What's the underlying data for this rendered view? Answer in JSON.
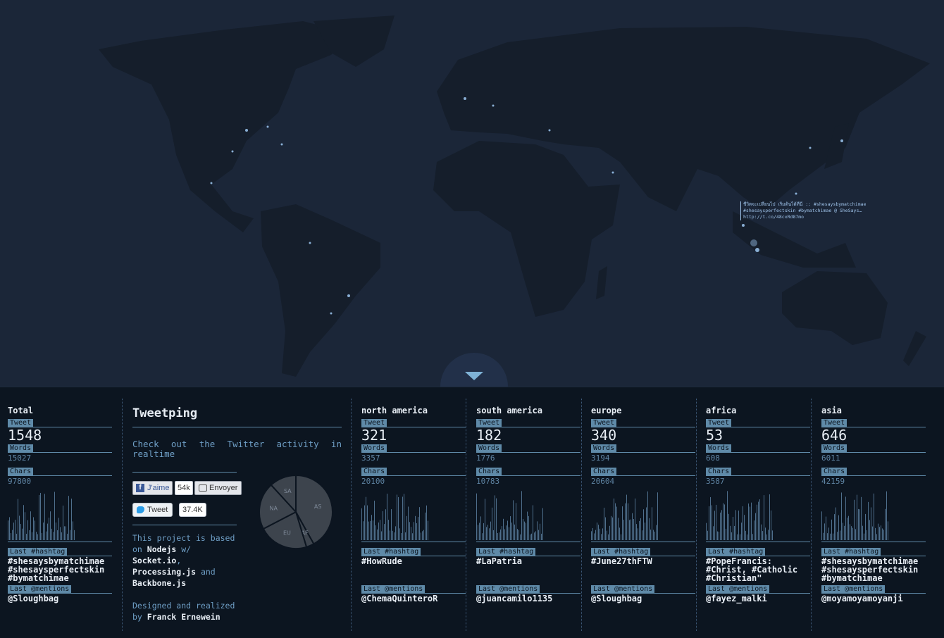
{
  "map": {
    "popup_text": [
      "ชีวิตจะเปลี่ยนไป เริ่มต้นได้ที่นี่ :: #shesaysbymatchimae",
      "#shesaysperfectskin #bymatchimae @ SheSays…",
      "http://t.co/48cxRd87mo"
    ]
  },
  "total": {
    "title": "Total",
    "tweet_label": "Tweet",
    "tweets": "1548",
    "words_label": "Words",
    "words": "15027",
    "chars_label": "Chars",
    "chars": "97800",
    "hashtag_label": "Last #hashtag",
    "hashtags": "#shesaysbymatchimae\n#shesaysperfectskin\n#bymatchimae",
    "mentions_label": "Last @mentions",
    "mentions": "@Sloughbag"
  },
  "about": {
    "title": "Tweetping",
    "subtitle": "Check out the Twitter activity in realtime",
    "like_label": "J'aime",
    "like_count": "54k",
    "send_label": "Envoyer",
    "tweet_label": "Tweet",
    "tweet_count": "37.4K",
    "project_line1": "This project is based",
    "project_line2a": "on ",
    "project_line2b": "Nodejs",
    "project_line2c": " w/",
    "project_line3": "Socket.io",
    "project_line3c": ",",
    "project_line4a": "Processing.js",
    "project_line4b": " and",
    "project_line5": "Backbone.js",
    "designed_line1": "Designed and realized",
    "designed_line2a": "by ",
    "designed_line2b": "Franck Ernewein",
    "pie": [
      {
        "label": "AS",
        "value": 646
      },
      {
        "label": "AF",
        "value": 53
      },
      {
        "label": "EU",
        "value": 340
      },
      {
        "label": "NA",
        "value": 321
      },
      {
        "label": "SA",
        "value": 182
      }
    ]
  },
  "regions": [
    {
      "key": "north-america",
      "name": "north america",
      "tweet_label": "Tweet",
      "tweets": "321",
      "words_label": "Words",
      "words": "3357",
      "chars_label": "Chars",
      "chars": "20100",
      "hashtag_label": "Last #hashtag",
      "hashtags": "#HowRude",
      "mentions_label": "Last @mentions",
      "mentions": "@ChemaQuinteroR"
    },
    {
      "key": "south-america",
      "name": "south america",
      "tweet_label": "Tweet",
      "tweets": "182",
      "words_label": "Words",
      "words": "1776",
      "chars_label": "Chars",
      "chars": "10783",
      "hashtag_label": "Last #hashtag",
      "hashtags": "#LaPatria",
      "mentions_label": "Last @mentions",
      "mentions": "@juancamilo1135"
    },
    {
      "key": "europe",
      "name": "europe",
      "tweet_label": "Tweet",
      "tweets": "340",
      "words_label": "Words",
      "words": "3194",
      "chars_label": "Chars",
      "chars": "20604",
      "hashtag_label": "Last #hashtag",
      "hashtags": "#June27thFTW",
      "mentions_label": "Last @mentions",
      "mentions": "@Sloughbag"
    },
    {
      "key": "africa",
      "name": "africa",
      "tweet_label": "Tweet",
      "tweets": "53",
      "words_label": "Words",
      "words": "608",
      "chars_label": "Chars",
      "chars": "3587",
      "hashtag_label": "Last #hashtag",
      "hashtags": "#PopeFrancis:\n#Christ, #Catholic\n#Christian\"",
      "mentions_label": "Last @mentions",
      "mentions": "@fayez_malki"
    },
    {
      "key": "asia",
      "name": "asia",
      "tweet_label": "Tweet",
      "tweets": "646",
      "words_label": "Words",
      "words": "6011",
      "chars_label": "Chars",
      "chars": "42159",
      "hashtag_label": "Last #hashtag",
      "hashtags": "#shesaysbymatchimae\n#shesaysperfectskin\n#bymatchimae",
      "mentions_label": "Last @mentions",
      "mentions": "@moyamoyamoyanji"
    }
  ],
  "colors": {
    "accent": "#5f8aa8",
    "text": "#e8eef5",
    "land": "#151e2b",
    "ocean": "#1b2638"
  }
}
